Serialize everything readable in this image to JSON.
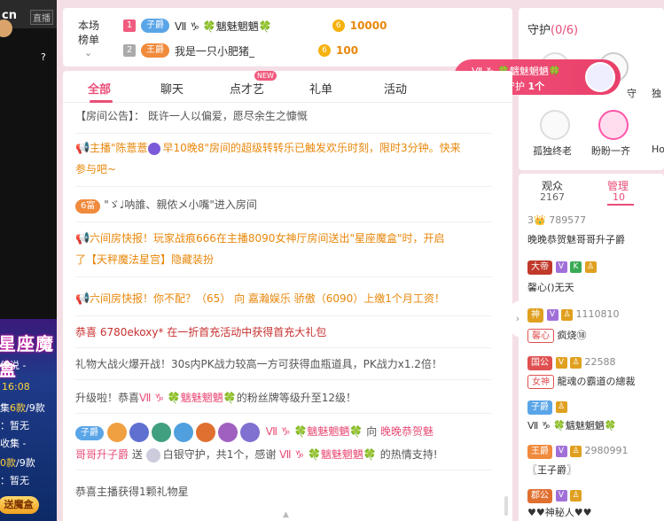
{
  "left_strip": {
    "cn": "cn",
    "live": "直播",
    "help": "?",
    "promo_title": "星座魔盒",
    "legend": "传说 -",
    "time": "16:08",
    "line1_prefix": "集",
    "line1_hl": "6款",
    "line1_suffix": "/9款",
    "line2": "：暂无",
    "line3": "收集 -",
    "line4_hl": "0款",
    "line4_suffix": "/9款",
    "line5": "：暂无",
    "button": "送魔盒"
  },
  "rank": {
    "label": "本场榜单",
    "rows": [
      {
        "num": "1",
        "badge": "子爵",
        "badge_color": "#5aa5e8",
        "name": "Ⅶ ♑ 🍀魑魅魍魉🍀",
        "amount": "10000"
      },
      {
        "num": "2",
        "badge": "王爵",
        "badge_color": "#f08a3c",
        "name": "我是一只小肥猪_",
        "amount": "100"
      }
    ]
  },
  "guard": {
    "title": "守护",
    "count": "(0/6)",
    "names": [
      "孤独终老",
      "盼盼一齐",
      "Ho",
      "守",
      "独"
    ]
  },
  "silver_popup": {
    "line1": "Ⅶ ♑ 🍀魑魅魍魉🍀",
    "line2_a": "白银守护",
    "line2_b": "1个"
  },
  "tabs": [
    {
      "label": "全部",
      "active": true
    },
    {
      "label": "聊天",
      "active": false
    },
    {
      "label": "点才艺",
      "active": false
    },
    {
      "label": "礼单",
      "active": false
    },
    {
      "label": "活动",
      "active": false
    }
  ],
  "new_badge": "NEW",
  "messages": {
    "m1": "【房间公告】： 既许一人以偏爱，愿尽余生之慷慨",
    "m2a": "主播\"陈薏薏",
    "m2b": "早10晚8\"房间的超级转转乐已触发欢乐时刻，限时3分钟。快来",
    "m2c": "参与吧~",
    "m3_badge": "6富",
    "m3": "\"ゞ♩呐誰、親侬メ小嘴\"进入房间",
    "m4a": "六间房快报！玩家战痕666在主播8090",
    "m4b": "女神厅房间送出\"星座魔盒\"时，开启",
    "m4c": "了【天秤魔法星宫】隐藏装扮",
    "m5": "六间房快报！你不配？（65） 向 嘉瀚娱乐",
    "m5b": "骄傲（6090）上缴1个月工资！",
    "m6": "恭喜 6780ekoxy* 在一折首充活动中获得首充大礼包",
    "m7": "礼物大战火爆开战！30s内PK战力较高一方可获得血瓶道具，PK战力x1.2倍！",
    "m8a": "升级啦！恭喜",
    "m8b": "Ⅶ ♑ 🍀魑魅魍魉🍀",
    "m8c": "的粉丝牌等级升至12级！",
    "m9_badge": "子爵",
    "m9a": "Ⅶ ♑ 🍀魑魅魍魉🍀",
    "m9b": "向",
    "m9c": "晚晚恭贺魅",
    "m9d": "哥哥升子爵",
    "m9e": "送",
    "m9f": "白银守护，共1个，感谢",
    "m9g": "Ⅶ ♑ 🍀魑魅魍魉🍀",
    "m9h": "的热情支持!",
    "m10": "恭喜主播获得1颗礼物星"
  },
  "audience": {
    "tab1": "观众",
    "tab1_count": "2167",
    "tab2": "管理",
    "tab2_count": "10",
    "rows": [
      {
        "text": "3👑 789577"
      },
      {
        "text": "晚晚恭贺魅哥哥升子爵"
      },
      {
        "badge": "大帝",
        "badge_color": "#c0392b"
      },
      {
        "text": "馨心()无天"
      },
      {
        "badge": "神",
        "badge_color": "#e0a020",
        "num": "1110810"
      },
      {
        "text_a": "馨心",
        "text_b": "疯烧⑱"
      },
      {
        "badge": "国公",
        "badge_color": "#e05050",
        "num": "22588"
      },
      {
        "text_a": "女神",
        "text_b": "龍魂の霸道の總裁"
      },
      {
        "badge": "子爵",
        "badge_color": "#5aa5e8"
      },
      {
        "text": "Ⅶ ♑ 🍀魑魅魍魉🍀"
      },
      {
        "badge": "王爵",
        "badge_color": "#f08a3c",
        "num": "2980991"
      },
      {
        "text": "〖王子爵〗"
      },
      {
        "badge": "郡公",
        "badge_color": "#e07030"
      },
      {
        "text": "♥♥神秘人♥♥"
      }
    ]
  }
}
